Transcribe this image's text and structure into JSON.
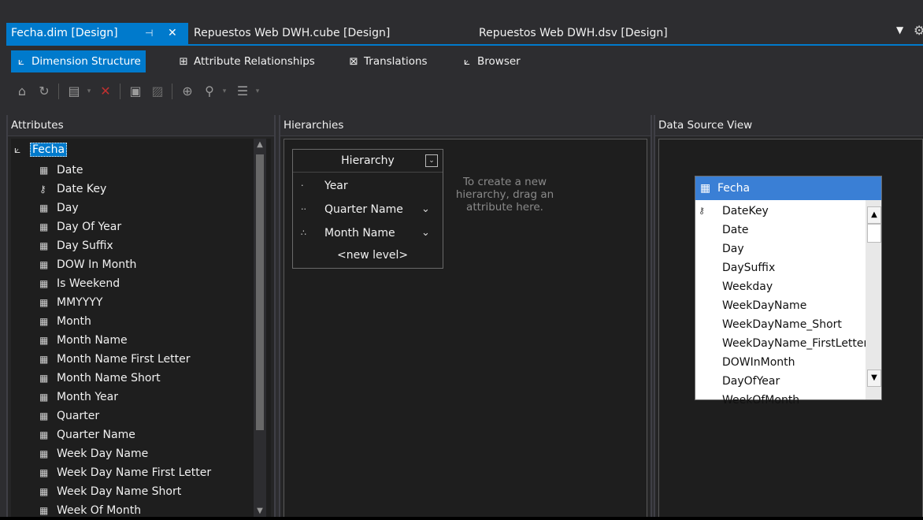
{
  "tabs": [
    {
      "label": "Fecha.dim [Design]",
      "active": true
    },
    {
      "label": "Repuestos Web DWH.cube [Design]",
      "active": false
    },
    {
      "label": "Repuestos Web DWH.dsv [Design]",
      "active": false
    }
  ],
  "tab_icons": {
    "pin": "pin-icon",
    "close": "close-icon",
    "menu": "dropdown-icon",
    "gear": "gear-icon"
  },
  "designer_tabs": [
    {
      "label": "Dimension Structure",
      "icon": "dimension-structure-icon",
      "active": true
    },
    {
      "label": "Attribute Relationships",
      "icon": "attribute-relationships-icon",
      "active": false
    },
    {
      "label": "Translations",
      "icon": "translations-icon",
      "active": false
    },
    {
      "label": "Browser",
      "icon": "browser-icon",
      "active": false
    }
  ],
  "panels": {
    "attributes": "Attributes",
    "hierarchies": "Hierarchies",
    "dsv": "Data Source View"
  },
  "attributes": {
    "root": "Fecha",
    "items": [
      "Date",
      "Date Key",
      "Day",
      "Day Of Year",
      "Day Suffix",
      "DOW In Month",
      "Is Weekend",
      "MMYYYY",
      "Month",
      "Month Name",
      "Month Name First Letter",
      "Month Name Short",
      "Month Year",
      "Quarter",
      "Quarter Name",
      "Week Day Name",
      "Week Day Name First Letter",
      "Week Day Name Short",
      "Week Of Month"
    ]
  },
  "hierarchy": {
    "title": "Hierarchy",
    "levels": [
      "Year",
      "Quarter Name",
      "Month Name"
    ],
    "new_level": "<new level>",
    "hint": "To create a new hierarchy, drag an attribute here."
  },
  "dsv_table": {
    "name": "Fecha",
    "columns": [
      "DateKey",
      "Date",
      "Day",
      "DaySuffix",
      "Weekday",
      "WeekDayName",
      "WeekDayName_Short",
      "WeekDayName_FirstLetter",
      "DOWInMonth",
      "DayOfYear",
      "WeekOfMonth"
    ]
  },
  "colors": {
    "accent": "#007acc",
    "table_header": "#3a7fd5",
    "background": "#2d2d30"
  }
}
